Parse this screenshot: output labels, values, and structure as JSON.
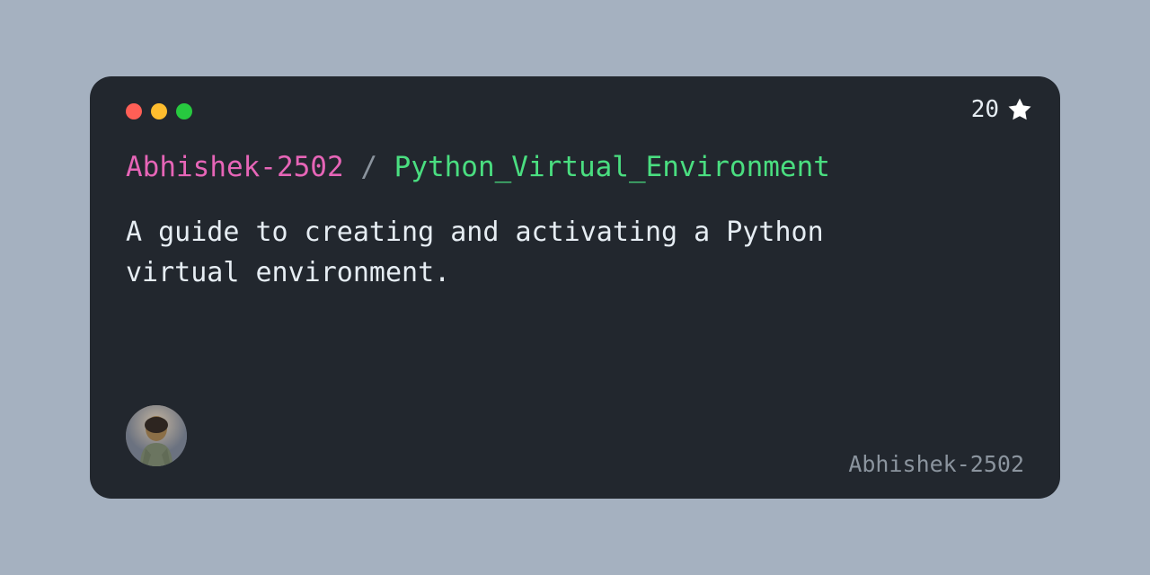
{
  "owner": "Abhishek-2502",
  "separator": "/",
  "repo": "Python_Virtual_Environment",
  "description": "A guide to creating and activating a Python virtual environment.",
  "star_count": "20",
  "username": "Abhishek-2502"
}
